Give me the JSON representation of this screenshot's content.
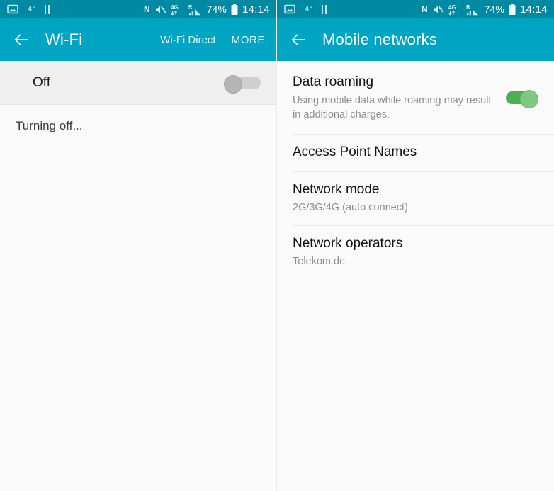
{
  "theme": {
    "statusbar_bg": "#0089a3",
    "appbar_bg": "#00a5c4",
    "panel_bg": "#fafafa",
    "switch_on_track": "#4caf50",
    "switch_on_knob": "#81c784",
    "switch_off_track": "#cfcfcf",
    "switch_off_knob": "#b5b5b5"
  },
  "statusbar": {
    "icons_left": [
      "screenshot-icon",
      "temperature-4-degrees",
      "pause-icon"
    ],
    "temperature": "4°",
    "icons_right": [
      "nfc-icon",
      "mute-icon",
      "4g-data-icon",
      "roaming-signal-icon"
    ],
    "network_label": "4G",
    "roaming_label": "R",
    "battery_percent": "74%",
    "time": "14:14"
  },
  "left_panel": {
    "appbar": {
      "back_icon": "arrow-left-icon",
      "title": "Wi-Fi",
      "action_direct": "Wi-Fi Direct",
      "action_more": "MORE"
    },
    "switch_row": {
      "label": "Off",
      "state": "off"
    },
    "status_text": "Turning off..."
  },
  "right_panel": {
    "appbar": {
      "back_icon": "arrow-left-icon",
      "title": "Mobile networks"
    },
    "rows": [
      {
        "title": "Data roaming",
        "subtitle": "Using mobile data while roaming may result in additional charges.",
        "has_switch": true,
        "switch_state": "on"
      },
      {
        "title": "Access Point Names",
        "subtitle": "",
        "has_switch": false
      },
      {
        "title": "Network mode",
        "subtitle": "2G/3G/4G (auto connect)",
        "has_switch": false
      },
      {
        "title": "Network operators",
        "subtitle": "Telekom.de",
        "has_switch": false
      }
    ]
  }
}
